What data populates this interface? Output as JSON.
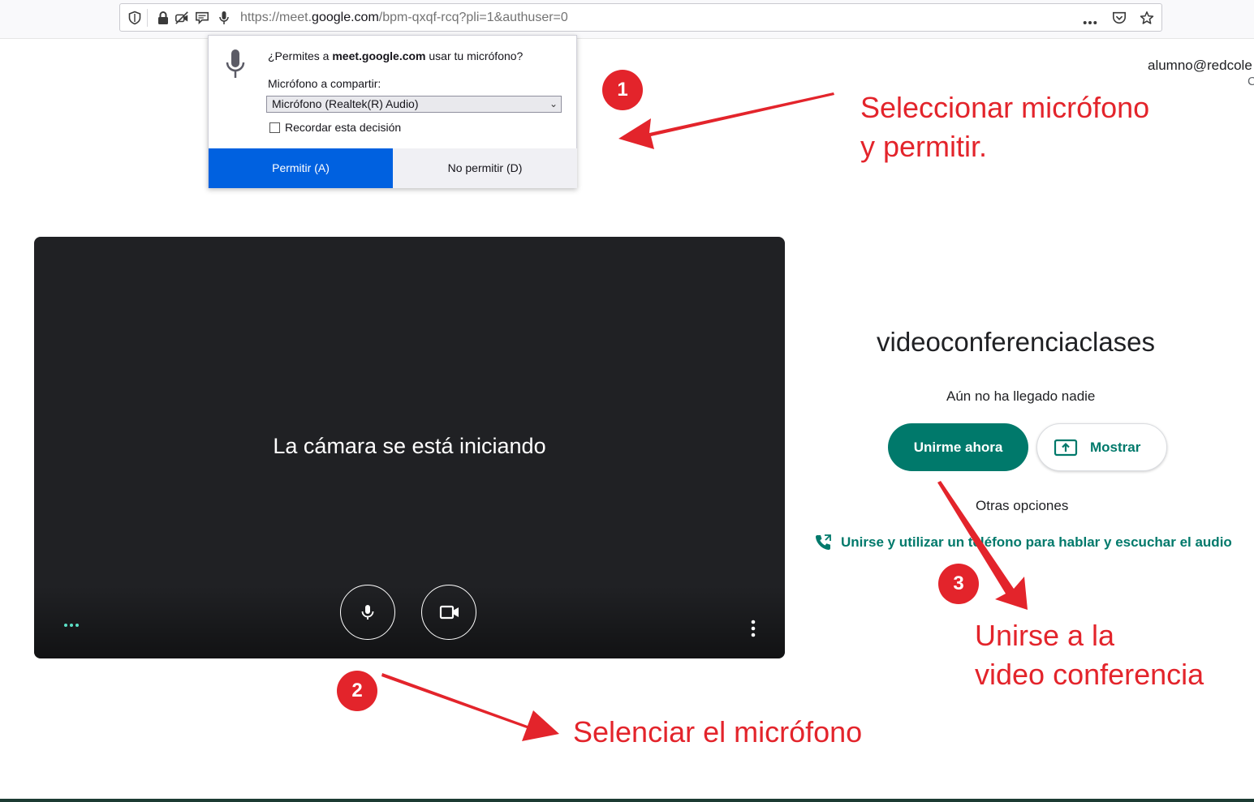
{
  "browser": {
    "url_prefix": "https://meet.",
    "url_domain": "google.com",
    "url_suffix": "/bpm-qxqf-rcq?pli=1&authuser=0"
  },
  "permission_popup": {
    "question_prefix": "¿Permites a ",
    "question_domain": "meet.google.com",
    "question_suffix": " usar tu micrófono?",
    "share_label": "Micrófono a compartir:",
    "selected_microphone": "Micrófono (Realtek(R) Audio)",
    "remember_label": "Recordar esta decisión",
    "remember_checked": false,
    "allow_label": "Permitir (A)",
    "deny_label": "No permitir (D)"
  },
  "account": {
    "email": "alumno@redcole",
    "secondary": "C"
  },
  "video": {
    "status_text": "La cámara se está iniciando",
    "mic_icon": "microphone-icon",
    "camera_icon": "videocam-icon"
  },
  "join_panel": {
    "meeting_name": "videoconferenciaclases",
    "participants_status": "Aún no ha llegado nadie",
    "join_label": "Unirme ahora",
    "present_label": "Mostrar",
    "other_options": "Otras opciones",
    "phone_option": "Unirse y utilizar un teléfono para hablar y escuchar el audio"
  },
  "annotations": [
    {
      "number": "1",
      "lines": [
        "Seleccionar micrófono",
        "y permitir."
      ]
    },
    {
      "number": "2",
      "lines": [
        "Selenciar el micrófono"
      ]
    },
    {
      "number": "3",
      "lines": [
        "Unirse a la",
        "video conferencia"
      ]
    }
  ],
  "colors": {
    "annotation_red": "#e3242b",
    "meet_green": "#00796b",
    "firefox_blue": "#0061e0",
    "video_bg": "#202124"
  }
}
